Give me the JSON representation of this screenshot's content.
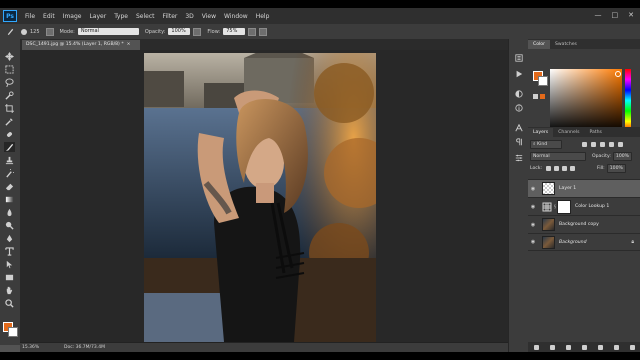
{
  "app": {
    "logo_text": "Ps"
  },
  "menu": [
    "File",
    "Edit",
    "Image",
    "Layer",
    "Type",
    "Select",
    "Filter",
    "3D",
    "View",
    "Window",
    "Help"
  ],
  "window_controls": {
    "minimize": "—",
    "maximize": "□",
    "close": "✕"
  },
  "options_bar": {
    "brush_size": "125",
    "mode_label": "Mode:",
    "mode_value": "Normal",
    "opacity_label": "Opacity:",
    "opacity_value": "100%",
    "flow_label": "Flow:",
    "flow_value": "75%"
  },
  "document": {
    "tab_title": "DSC_1491.jpg @ 15.4% (Layer 1, RGB/8) *",
    "tab_close": "×",
    "zoom_status": "15.36%",
    "doc_status": "Doc: 36.7M/73.4M"
  },
  "colors": {
    "foreground": "#e46a1a",
    "background": "#ffffff",
    "accent": "#31a8ff"
  },
  "color_panel": {
    "tabs": [
      "Color",
      "Swatches"
    ]
  },
  "layers_panel": {
    "tabs": [
      "Layers",
      "Channels",
      "Paths"
    ],
    "kind_label": "Kind",
    "blend_mode": "Normal",
    "opacity_label": "Opacity:",
    "opacity_value": "100%",
    "lock_label": "Lock:",
    "fill_label": "Fill:",
    "fill_value": "100%",
    "layers": [
      {
        "name": "Layer 1",
        "selected": true
      },
      {
        "name": "Color Lookup 1",
        "selected": false
      },
      {
        "name": "Background copy",
        "selected": false
      },
      {
        "name": "Background",
        "selected": false
      }
    ]
  },
  "icons": {
    "toolbar": [
      "move-icon",
      "marquee-icon",
      "lasso-icon",
      "quick-select-icon",
      "crop-icon",
      "eyedropper-icon",
      "healing-icon",
      "brush-icon",
      "clone-stamp-icon",
      "history-brush-icon",
      "eraser-icon",
      "gradient-icon",
      "blur-icon",
      "dodge-icon",
      "pen-icon",
      "type-icon",
      "path-select-icon",
      "shape-icon",
      "hand-icon",
      "zoom-icon"
    ]
  }
}
